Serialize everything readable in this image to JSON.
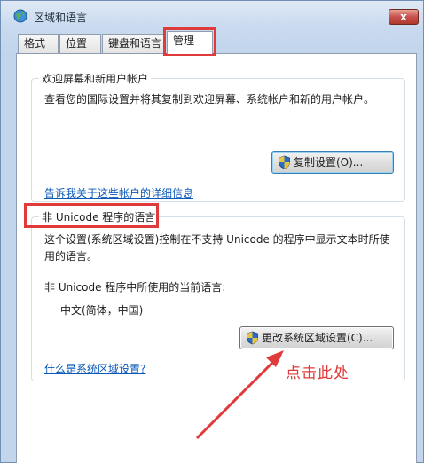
{
  "window": {
    "title": "区域和语言",
    "close_glyph": "x"
  },
  "tabs": [
    {
      "label": "格式",
      "active": false
    },
    {
      "label": "位置",
      "active": false
    },
    {
      "label": "键盘和语言",
      "active": false
    },
    {
      "label": "管理",
      "active": true
    }
  ],
  "welcome_group": {
    "title": "欢迎屏幕和新用户帐户",
    "description": "查看您的国际设置并将其复制到欢迎屏幕、系统帐户和新的用户帐户。",
    "copy_button_label": "复制设置(O)...",
    "info_link": "告诉我关于这些帐户的详细信息"
  },
  "non_unicode_group": {
    "title": "非 Unicode 程序的语言",
    "description_line1": "这个设置(系统区域设置)控制在不支持 Unicode 的程序中显示文本时所使",
    "description_line2": "用的语言。",
    "current_language_label": "非 Unicode 程序中所使用的当前语言:",
    "current_language_value": "中文(简体，中国)",
    "change_button_label": "更改系统区域设置(C)...",
    "info_link": "什么是系统区域设置?"
  },
  "annotation": {
    "text": "点击此处",
    "color": "#e03a3a"
  },
  "icons": [
    "globe-icon",
    "close-icon",
    "uac-shield-icon"
  ]
}
